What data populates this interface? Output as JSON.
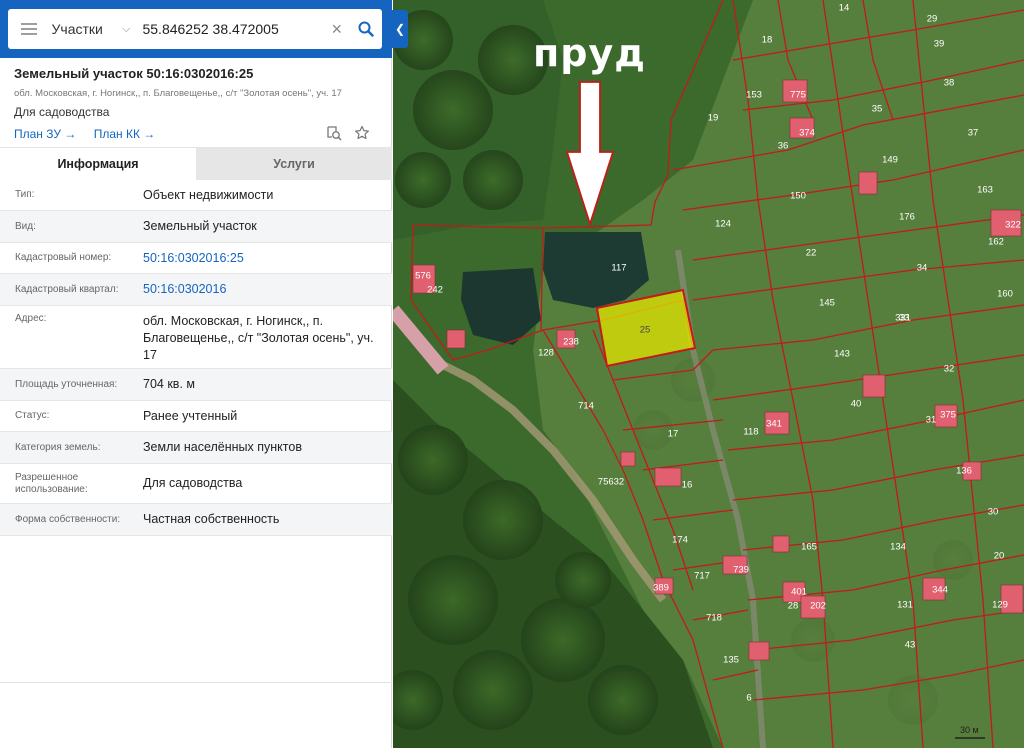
{
  "search": {
    "type_label": "Участки",
    "query": "55.846252 38.472005"
  },
  "parcel": {
    "title": "Земельный участок 50:16:0302016:25",
    "address_short": "обл. Московская, г. Ногинск,, п. Благовещенье,, с/т \"Золотая осень\", уч. 17",
    "usage": "Для садоводства",
    "plan_zu": "План ЗУ",
    "plan_kk": "План КК"
  },
  "tabs": [
    {
      "label": "Информация"
    },
    {
      "label": "Услуги"
    }
  ],
  "info_rows": [
    {
      "label": "Тип:",
      "value": "Объект недвижимости"
    },
    {
      "label": "Вид:",
      "value": "Земельный участок"
    },
    {
      "label": "Кадастровый номер:",
      "value": "50:16:0302016:25"
    },
    {
      "label": "Кадастровый квартал:",
      "value": "50:16:0302016"
    },
    {
      "label": "Адрес:",
      "value": "обл. Московская, г. Ногинск,, п. Благовещенье,, с/т \"Золотая осень\", уч. 17"
    },
    {
      "label": "Площадь уточненная:",
      "value": "704 кв. м"
    },
    {
      "label": "Статус:",
      "value": "Ранее учтенный"
    },
    {
      "label": "Категория земель:",
      "value": "Земли населённых пунктов"
    },
    {
      "label": "Разрешенное использование:",
      "value": "Для садоводства"
    },
    {
      "label": "Форма собственности:",
      "value": "Частная собственность"
    }
  ],
  "map": {
    "annotation": "пруд",
    "selected_plot": "25",
    "scale_label": "30 м",
    "plot_numbers": [
      "14",
      "29",
      "18",
      "39",
      "153",
      "775",
      "38",
      "19",
      "35",
      "374",
      "36",
      "37",
      "149",
      "150",
      "163",
      "124",
      "176",
      "322",
      "162",
      "22",
      "34",
      "117",
      "576",
      "242",
      "160",
      "145",
      "33",
      "331",
      "128",
      "238",
      "143",
      "32",
      "714",
      "40",
      "341",
      "31",
      "118",
      "17",
      "375",
      "136",
      "75632",
      "16",
      "30",
      "174",
      "165",
      "134",
      "20",
      "739",
      "717",
      "389",
      "401",
      "28",
      "202",
      "131",
      "344",
      "129",
      "718",
      "43",
      "135",
      "6"
    ]
  },
  "colors": {
    "brand_blue": "#1565c0",
    "selected_plot_fill": "#e3e600",
    "boundary_red": "#c41a1a",
    "roof_pink": "#e06070"
  }
}
